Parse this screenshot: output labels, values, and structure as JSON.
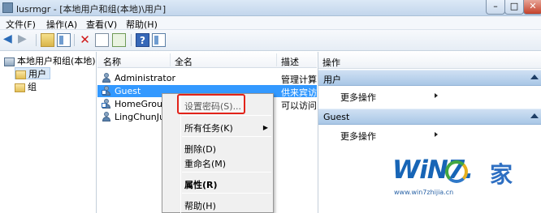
{
  "window": {
    "title": "lusrmgr - [本地用户和组(本地)\\用户]"
  },
  "menu": [
    {
      "label": "文件(F)"
    },
    {
      "label": "操作(A)"
    },
    {
      "label": "查看(V)"
    },
    {
      "label": "帮助(H)"
    }
  ],
  "tree": {
    "root": "本地用户和组(本地)",
    "items": [
      {
        "label": "用户"
      },
      {
        "label": "组"
      }
    ]
  },
  "list": {
    "columns": [
      "名称",
      "全名",
      "描述"
    ],
    "rows": [
      {
        "name": "Administrator",
        "fullname": "",
        "desc": "管理计算"
      },
      {
        "name": "Guest",
        "fullname": "",
        "desc": "供来宾访"
      },
      {
        "name": "HomeGroup",
        "fullname": "",
        "desc": "可以访问"
      },
      {
        "name": "LingChunJu",
        "fullname": "",
        "desc": ""
      }
    ]
  },
  "context_menu": {
    "items": [
      {
        "label": "设置密码(S)..."
      },
      {
        "label": "所有任务(K)"
      },
      {
        "label": "删除(D)"
      },
      {
        "label": "重命名(M)"
      },
      {
        "label": "属性(R)"
      },
      {
        "label": "帮助(H)"
      }
    ]
  },
  "actions": {
    "header": "操作",
    "sections": [
      {
        "title": "用户",
        "more": "更多操作"
      },
      {
        "title": "Guest",
        "more": "更多操作"
      }
    ]
  },
  "watermark": {
    "logo": "WiN7.",
    "jia": "家",
    "url": "www.win7zhijia.cn"
  },
  "colors": {
    "selection": "#3399ff",
    "highlight_box": "#e2231a",
    "section_header": "#bcd3ec"
  }
}
